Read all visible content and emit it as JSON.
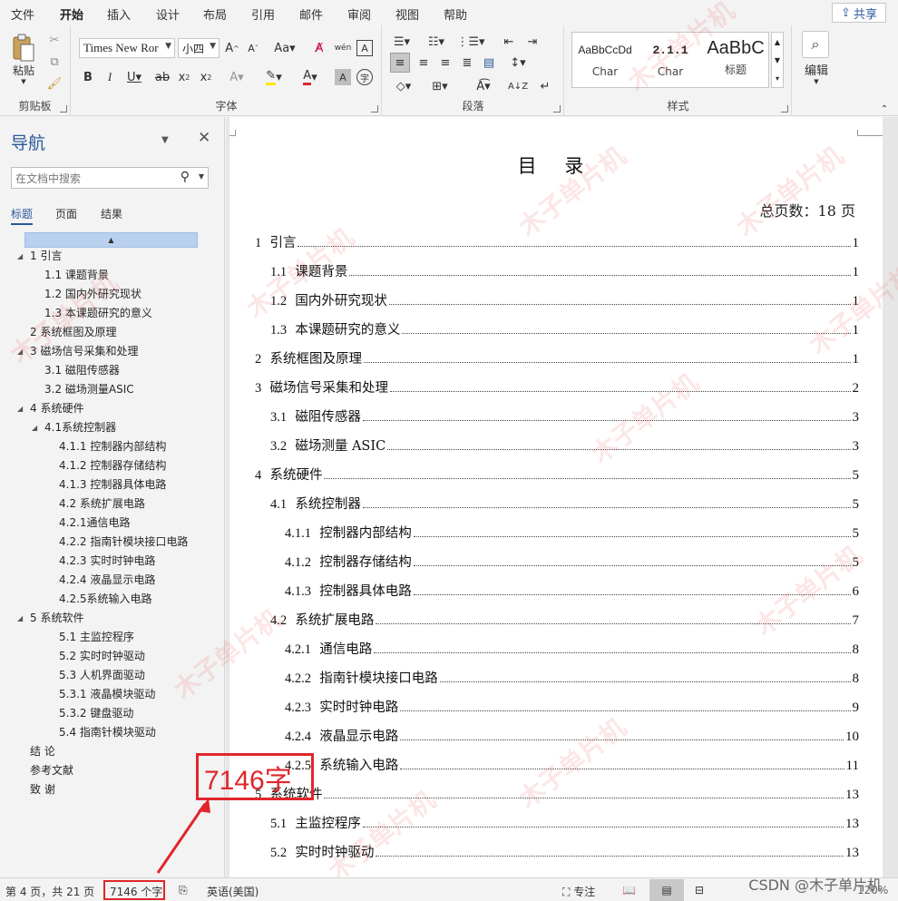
{
  "tabs": [
    "文件",
    "开始",
    "插入",
    "设计",
    "布局",
    "引用",
    "邮件",
    "审阅",
    "视图",
    "帮助"
  ],
  "active_tab": "开始",
  "share_label": "共享",
  "ribbon": {
    "clipboard": {
      "label": "剪贴板",
      "paste": "粘贴"
    },
    "font": {
      "label": "字体",
      "font_name": "Times New Ror",
      "font_size": "小四"
    },
    "paragraph": {
      "label": "段落"
    },
    "styles": {
      "label": "样式",
      "items": [
        {
          "sample": "AaBbCcDd",
          "name": "Char"
        },
        {
          "sample": "2.1.1",
          "name": "Char"
        },
        {
          "sample": "AaBbC",
          "name": "标题"
        }
      ]
    },
    "editing": {
      "label": "编辑"
    }
  },
  "nav": {
    "title": "导航",
    "search_placeholder": "在文档中搜索",
    "tabs": [
      "标题",
      "页面",
      "结果"
    ],
    "items": [
      {
        "text": "1 引言",
        "level": 1,
        "expanded": true
      },
      {
        "text": "1.1  课题背景",
        "level": 2
      },
      {
        "text": "1.2  国内外研究现状",
        "level": 2
      },
      {
        "text": "1.3  本课题研究的意义",
        "level": 2
      },
      {
        "text": "2 系统框图及原理",
        "level": 1
      },
      {
        "text": "3 磁场信号采集和处理",
        "level": 1,
        "expanded": true
      },
      {
        "text": "3.1 磁阻传感器",
        "level": 2
      },
      {
        "text": "3.2 磁场测量ASIC",
        "level": 2
      },
      {
        "text": "4 系统硬件",
        "level": 1,
        "expanded": true
      },
      {
        "text": "4.1系统控制器",
        "level": 2,
        "expanded": true
      },
      {
        "text": "4.1.1 控制器内部结构",
        "level": 3
      },
      {
        "text": "4.1.2 控制器存储结构",
        "level": 3
      },
      {
        "text": "4.1.3 控制器具体电路",
        "level": 3
      },
      {
        "text": "4.2 系统扩展电路",
        "level": 3
      },
      {
        "text": "4.2.1通信电路",
        "level": 3
      },
      {
        "text": "4.2.2 指南针模块接口电路",
        "level": 3
      },
      {
        "text": "4.2.3 实时时钟电路",
        "level": 3
      },
      {
        "text": "4.2.4 液晶显示电路",
        "level": 3
      },
      {
        "text": "4.2.5系统输入电路",
        "level": 3
      },
      {
        "text": "5 系统软件",
        "level": 1,
        "expanded": true
      },
      {
        "text": "5.1 主监控程序",
        "level": 3
      },
      {
        "text": "5.2 实时时钟驱动",
        "level": 3
      },
      {
        "text": "5.3 人机界面驱动",
        "level": 3
      },
      {
        "text": "5.3.1 液晶模块驱动",
        "level": 3
      },
      {
        "text": "5.3.2 键盘驱动",
        "level": 3
      },
      {
        "text": "5.4 指南针模块驱动",
        "level": 3
      },
      {
        "text": "结    论",
        "level": 1
      },
      {
        "text": "参考文献",
        "level": 1
      },
      {
        "text": "致    谢",
        "level": 1
      }
    ]
  },
  "document": {
    "toc_title": "目  录",
    "total_pages": "总页数：18 页",
    "entries": [
      {
        "num": "1",
        "title": "引言",
        "page": "1",
        "level": 1
      },
      {
        "num": "1.1",
        "title": "课题背景",
        "page": "1",
        "level": 2
      },
      {
        "num": "1.2",
        "title": "国内外研究现状",
        "page": "1",
        "level": 2
      },
      {
        "num": "1.3",
        "title": "本课题研究的意义",
        "page": "1",
        "level": 2
      },
      {
        "num": "2",
        "title": "系统框图及原理",
        "page": "1",
        "level": 1
      },
      {
        "num": "3",
        "title": "磁场信号采集和处理",
        "page": "2",
        "level": 1
      },
      {
        "num": "3.1",
        "title": "磁阻传感器",
        "page": "3",
        "level": 2
      },
      {
        "num": "3.2",
        "title": "磁场测量 ASIC",
        "page": "3",
        "level": 2
      },
      {
        "num": "4",
        "title": "系统硬件",
        "page": "5",
        "level": 1
      },
      {
        "num": "4.1",
        "title": "系统控制器",
        "page": "5",
        "level": 2
      },
      {
        "num": "4.1.1",
        "title": "控制器内部结构",
        "page": "5",
        "level": 3
      },
      {
        "num": "4.1.2",
        "title": "控制器存储结构",
        "page": "5",
        "level": 3
      },
      {
        "num": "4.1.3",
        "title": "控制器具体电路",
        "page": "6",
        "level": 3
      },
      {
        "num": "4.2",
        "title": "系统扩展电路",
        "page": "7",
        "level": 2
      },
      {
        "num": "4.2.1",
        "title": "通信电路",
        "page": "8",
        "level": 3
      },
      {
        "num": "4.2.2",
        "title": "指南针模块接口电路",
        "page": "8",
        "level": 3
      },
      {
        "num": "4.2.3",
        "title": "实时时钟电路",
        "page": "9",
        "level": 3
      },
      {
        "num": "4.2.4",
        "title": "液晶显示电路",
        "page": "10",
        "level": 3
      },
      {
        "num": "4.2.5",
        "title": "系统输入电路",
        "page": "11",
        "level": 3
      },
      {
        "num": "5",
        "title": "系统软件",
        "page": "13",
        "level": 1
      },
      {
        "num": "5.1",
        "title": "主监控程序",
        "page": "13",
        "level": 2
      },
      {
        "num": "5.2",
        "title": "实时时钟驱动",
        "page": "13",
        "level": 2
      }
    ]
  },
  "status": {
    "page_info": "第 4 页，共 21 页",
    "word_count": "7146 个字",
    "language": "英语(美国)",
    "focus": "专注",
    "zoom": "120%"
  },
  "annotation": {
    "text": "7146字"
  },
  "watermark": {
    "text": "木子单片机"
  },
  "csdn_credit": "CSDN @木子单片机",
  "colors": {
    "accent": "#2b579a",
    "annotation": "#e0262b"
  }
}
